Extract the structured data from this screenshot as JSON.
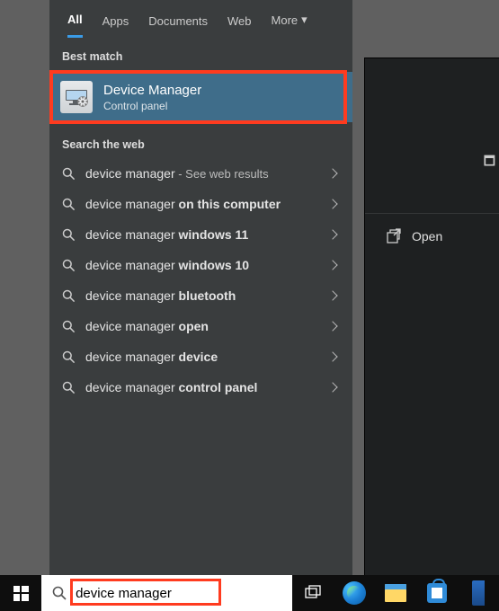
{
  "tabs": [
    "All",
    "Apps",
    "Documents",
    "Web",
    "More"
  ],
  "active_tab": 0,
  "sections": {
    "best_match": "Best match",
    "search_web": "Search the web"
  },
  "best_match": {
    "title": "Device Manager",
    "subtitle": "Control panel"
  },
  "web_results": [
    {
      "prefix": "device manager",
      "bold": "",
      "suffix": " - See web results",
      "suffix_gray": true
    },
    {
      "prefix": "device manager ",
      "bold": "on this computer",
      "suffix": ""
    },
    {
      "prefix": "device manager ",
      "bold": "windows 11",
      "suffix": ""
    },
    {
      "prefix": "device manager ",
      "bold": "windows 10",
      "suffix": ""
    },
    {
      "prefix": "device manager ",
      "bold": "bluetooth",
      "suffix": ""
    },
    {
      "prefix": "device manager ",
      "bold": "open",
      "suffix": ""
    },
    {
      "prefix": "device manager ",
      "bold": "device",
      "suffix": ""
    },
    {
      "prefix": "device manager ",
      "bold": "control panel",
      "suffix": ""
    }
  ],
  "preview": {
    "open_label": "Open"
  },
  "search": {
    "query": "device manager"
  }
}
